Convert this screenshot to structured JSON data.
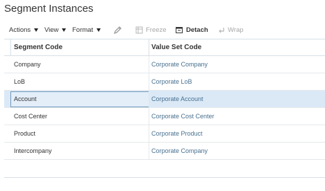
{
  "page": {
    "title": "Segment Instances"
  },
  "toolbar": {
    "actions_label": "Actions",
    "view_label": "View",
    "format_label": "Format",
    "edit_icon": "pencil-icon",
    "freeze_label": "Freeze",
    "detach_label": "Detach",
    "wrap_label": "Wrap"
  },
  "table": {
    "headers": {
      "segment_code": "Segment Code",
      "value_set_code": "Value Set Code"
    },
    "rows": [
      {
        "segment_code": "Company",
        "value_set_code": "Corporate Company"
      },
      {
        "segment_code": "LoB",
        "value_set_code": "Corporate LoB"
      },
      {
        "segment_code": "Account",
        "value_set_code": "Corporate Account"
      },
      {
        "segment_code": "Cost Center",
        "value_set_code": "Corporate Cost Center"
      },
      {
        "segment_code": "Product",
        "value_set_code": "Corporate Product"
      },
      {
        "segment_code": "Intercompany",
        "value_set_code": "Corporate Company"
      }
    ],
    "selected_row": "Account"
  },
  "colors": {
    "link": "#47708f",
    "selected_row_bg": "#dbe9f7",
    "focus_border": "#6f98bb",
    "disabled_text": "#a7a7a7"
  }
}
